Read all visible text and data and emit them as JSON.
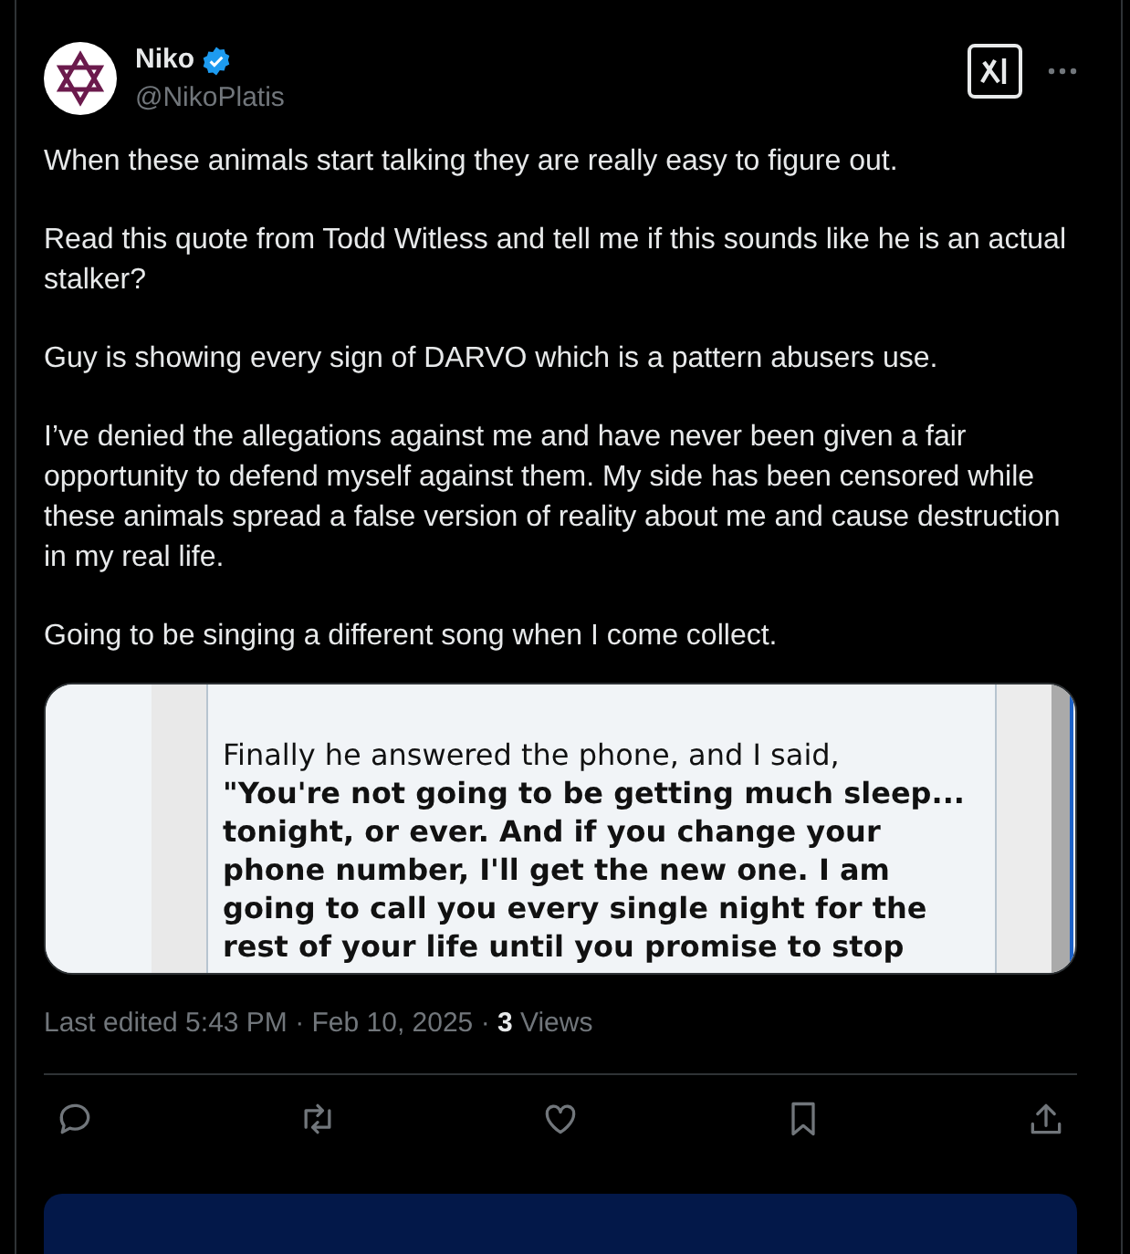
{
  "author": {
    "name": "Niko",
    "verified": true,
    "handle": "@NikoPlatis"
  },
  "paragraphs": [
    "When these animals start talking they are really easy to figure out.",
    "Read this quote from Todd Witless and tell me if this sounds like he is an actual stalker?",
    "Guy is showing every sign of DARVO which is a pattern abusers use.",
    "I’ve denied the allegations against me and have never been given a fair opportunity to defend myself against them. My side has been censored while these animals spread a false version of reality about me and cause destruction in my real life.",
    "Going to be singing a different song when I come collect."
  ],
  "quote_image": {
    "intro": "Finally he answered the phone, and I said,",
    "quote": "\"You're not going to be getting much sleep... tonight, or ever. And if you change your phone number, I'll get the new one. I am going to call you every single night for the rest of your life until you promise to stop"
  },
  "meta": {
    "edited": "Last edited 5:43 PM · Feb 10, 2025 · ",
    "views_count": "3",
    "views_label": " Views"
  },
  "actions": [
    {
      "kind": "reply"
    },
    {
      "kind": "repost"
    },
    {
      "kind": "like"
    },
    {
      "kind": "bookmark"
    },
    {
      "kind": "share"
    }
  ]
}
